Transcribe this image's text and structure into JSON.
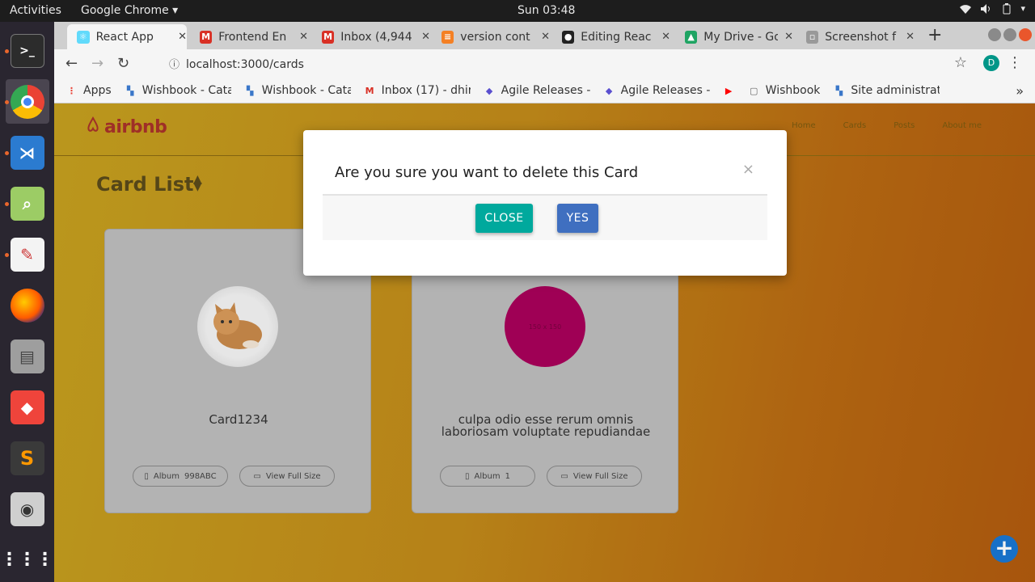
{
  "system": {
    "activities": "Activities",
    "app_menu": "Google Chrome ▾",
    "clock": "Sun 03:48"
  },
  "dock": [
    "terminal",
    "chrome",
    "vscode",
    "image-viewer",
    "text-editor",
    "firefox",
    "files",
    "anydesk",
    "sublime",
    "speakers",
    "apps-grid"
  ],
  "browser": {
    "tabs": [
      {
        "title": "React App",
        "color": "#61dafb",
        "glyph": "⚛"
      },
      {
        "title": "Frontend En",
        "color": "#d93025",
        "glyph": "M"
      },
      {
        "title": "Inbox (4,944",
        "color": "#d93025",
        "glyph": "M"
      },
      {
        "title": "version cont",
        "color": "#f48024",
        "glyph": "≡"
      },
      {
        "title": "Editing Reac",
        "color": "#222222",
        "glyph": "●"
      },
      {
        "title": "My Drive - Go",
        "color": "#1fa463",
        "glyph": "▲"
      },
      {
        "title": "Screenshot f",
        "color": "#999999",
        "glyph": "▫"
      }
    ],
    "new_tab": "+",
    "url": "localhost:3000/cards",
    "avatar_letter": "D",
    "bookmarks": [
      {
        "title": "Apps",
        "color": "#e94235",
        "glyph": "⋮"
      },
      {
        "title": "Wishbook - Catal",
        "color": "#3a77c9",
        "glyph": "▚"
      },
      {
        "title": "Wishbook - Catal",
        "color": "#3a77c9",
        "glyph": "▚"
      },
      {
        "title": "Inbox (17) - dhire",
        "color": "#d93025",
        "glyph": "M"
      },
      {
        "title": "Agile Releases - l",
        "color": "#5a4fcf",
        "glyph": "◆"
      },
      {
        "title": "Agile Releases - A",
        "color": "#5a4fcf",
        "glyph": "◆"
      },
      {
        "title": "",
        "color": "#ff0000",
        "glyph": "▶"
      },
      {
        "title": "Wishbook",
        "color": "#666666",
        "glyph": "▢"
      },
      {
        "title": "Site administrati",
        "color": "#3a77c9",
        "glyph": "▚"
      }
    ],
    "more": "»"
  },
  "site": {
    "brand": "airbnb",
    "nav": [
      "Home",
      "Cards",
      "Posts",
      "About me"
    ],
    "heading": "Card List",
    "cards": [
      {
        "name": "Card1234",
        "album_label": "Album",
        "album_value": "998ABC",
        "view_label": "View Full Size",
        "image": "kitten"
      },
      {
        "name": "culpa odio esse rerum omnis laboriosam voluptate repudiandae",
        "album_label": "Album",
        "album_value": "1",
        "view_label": "View Full Size",
        "image": "150 x 150"
      }
    ],
    "fab": "+"
  },
  "modal": {
    "title": "Are you sure you want to delete this Card",
    "close_x": "×",
    "close_label": "CLOSE",
    "yes_label": "YES"
  }
}
